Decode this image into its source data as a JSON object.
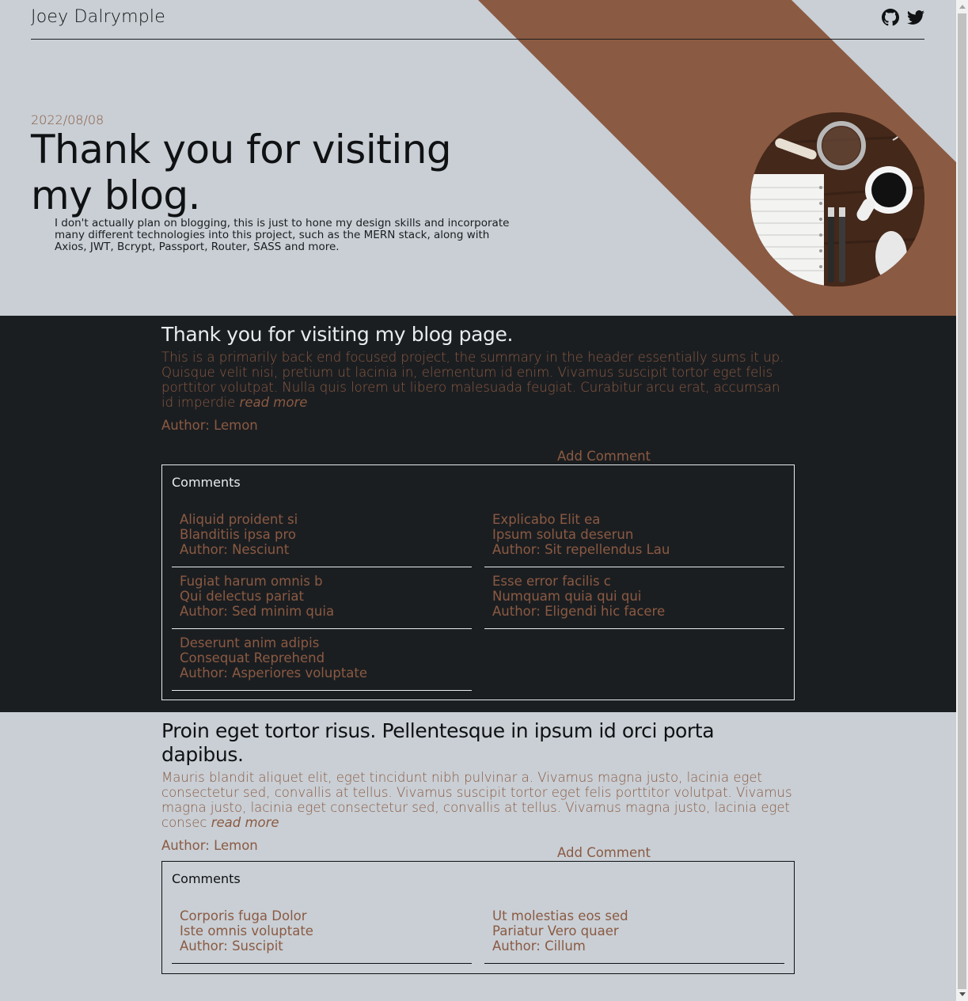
{
  "colors": {
    "accent": "#8b5a42",
    "light_bg": "#c9cfd5",
    "dark_bg": "#1b1e21"
  },
  "header": {
    "name": "Joey Dalrymple",
    "icons": [
      "github-icon",
      "twitter-icon"
    ]
  },
  "hero": {
    "date": "2022/08/08",
    "title": "Thank you for visiting my blog.",
    "summary": "I don't actually plan on blogging, this is just to hone my design skills and incorporate many different technologies into this project, such as the MERN stack, along with Axios, JWT, Bcrypt, Passport, Router, SASS and more."
  },
  "posts": [
    {
      "title": "Thank you for visiting my blog page.",
      "body": "This is a primarily back end focused project, the summary in the header essentially sums it up. Quisque velit nisi, pretium ut lacinia in, elementum id enim. Vivamus suscipit tortor eget felis porttitor volutpat. Nulla quis lorem ut libero malesuada feugiat. Curabitur arcu erat, accumsan id imperdie",
      "read_more": "read more",
      "author": "Author: Lemon",
      "add_comment": "Add Comment",
      "comments_heading": "Comments",
      "comments": [
        {
          "title": "Aliquid proident si",
          "body": "Blanditiis ipsa pro",
          "author": "Author: Nesciunt"
        },
        {
          "title": "Explicabo Elit ea",
          "body": "Ipsum soluta deserun",
          "author": "Author: Sit repellendus Lau"
        },
        {
          "title": "Fugiat harum omnis b",
          "body": "Qui delectus pariat",
          "author": "Author: Sed minim quia"
        },
        {
          "title": "Esse error facilis c",
          "body": "Numquam quia qui qui",
          "author": "Author: Eligendi hic facere"
        },
        {
          "title": "Deserunt anim adipis",
          "body": "Consequat Reprehend",
          "author": "Author: Asperiores voluptate"
        }
      ]
    },
    {
      "title": "Proin eget tortor risus. Pellentesque in ipsum id orci porta dapibus.",
      "body": "Mauris blandit aliquet elit, eget tincidunt nibh pulvinar a. Vivamus magna justo, lacinia eget consectetur sed, convallis at tellus. Vivamus suscipit tortor eget felis porttitor volutpat. Vivamus magna justo, lacinia eget consectetur sed, convallis at tellus. Vivamus magna justo, lacinia eget consec",
      "read_more": "read more",
      "author": "Author: Lemon",
      "add_comment": "Add Comment",
      "comments_heading": "Comments",
      "comments": [
        {
          "title": "Corporis fuga Dolor",
          "body": "Iste omnis voluptate",
          "author": "Author: Suscipit"
        },
        {
          "title": "Ut molestias eos sed",
          "body": "Pariatur Vero quaer",
          "author": "Author: Cillum"
        }
      ]
    }
  ]
}
